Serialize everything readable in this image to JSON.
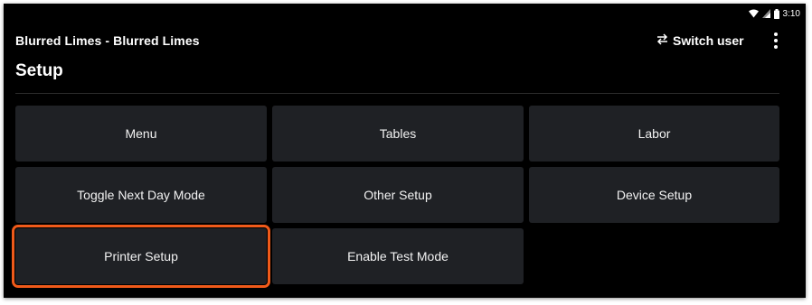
{
  "status_bar": {
    "time": "3:10",
    "icons": [
      "wifi-icon",
      "cell-signal-icon",
      "battery-icon"
    ]
  },
  "app_bar": {
    "title": "Blurred Limes - Blurred Limes",
    "switch_user_label": "Switch user",
    "switch_user_icon": "swap-arrows-icon",
    "overflow_icon": "more-vert-icon"
  },
  "page": {
    "title": "Setup"
  },
  "tiles": [
    {
      "label": "Menu"
    },
    {
      "label": "Tables"
    },
    {
      "label": "Labor"
    },
    {
      "label": "Toggle Next Day Mode"
    },
    {
      "label": "Other Setup"
    },
    {
      "label": "Device Setup"
    },
    {
      "label": "Printer Setup",
      "highlighted": true
    },
    {
      "label": "Enable Test Mode"
    }
  ],
  "colors": {
    "background": "#000000",
    "tile": "#1f2125",
    "highlight": "#f05a1a",
    "text": "#ffffff"
  }
}
